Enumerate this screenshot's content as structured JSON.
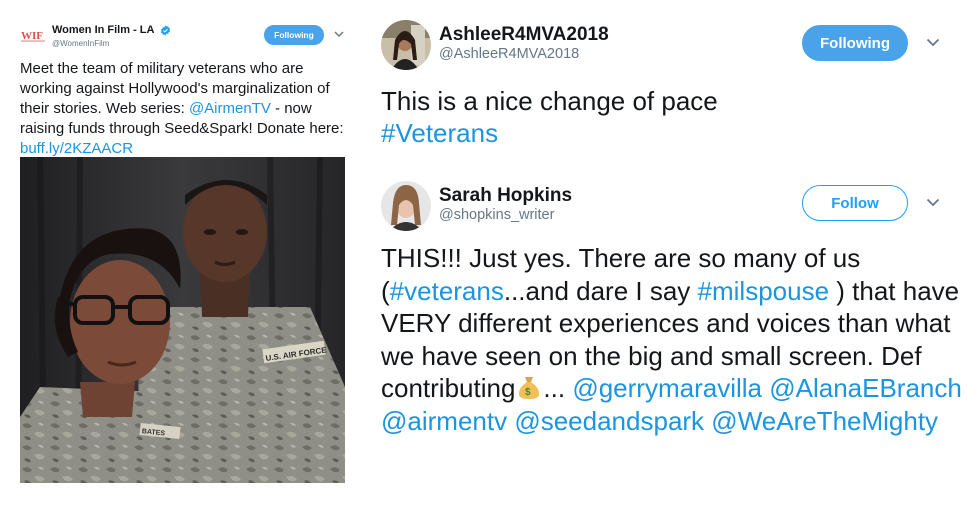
{
  "tweet_left": {
    "author_name": "Women In Film - LA",
    "handle": "@WomenInFilm",
    "logo_text": "WIF",
    "verified_icon": "verified-badge-icon",
    "follow_button": "Following",
    "text_1": "Meet the team of military veterans who are working against Hollywood's marginalization of their stories. Web series: ",
    "mention_1": "@AirmenTV",
    "text_2": " - now raising funds through Seed&Spark! Donate here: ",
    "link_1": "buff.ly/2KZAACR",
    "photo_patch_1": "U.S. AIR FORCE",
    "photo_patch_2": "BATES",
    "colors": {
      "accent": "#1da1f2",
      "button_fill": "#4aa3e8",
      "logo_red": "#d9534f"
    }
  },
  "tweet_right_1": {
    "author_name": "AshleeR4MVA2018",
    "handle": "@AshleeR4MVA2018",
    "follow_button": "Following",
    "text_1": "This is a nice change of pace",
    "hashtag_1": "#Veterans"
  },
  "tweet_right_2": {
    "author_name": "Sarah Hopkins",
    "handle": "@shopkins_writer",
    "follow_button": "Follow",
    "text_1": "THIS!!!  Just yes. There are so many of us (",
    "hashtag_1": "#veterans",
    "text_2": "...and dare I say ",
    "hashtag_2": "#milspouse",
    "text_3": " ) that have VERY different experiences and voices than what we have seen on the big and small screen. Def contributing",
    "emoji": "money-bag-icon",
    "text_4": "... ",
    "mention_1": "@gerrymaravilla",
    "mention_2": "@AlanaEBranch",
    "mention_3": "@airmentv",
    "mention_4": "@seedandspark",
    "mention_5": "@WeAreTheMighty"
  }
}
